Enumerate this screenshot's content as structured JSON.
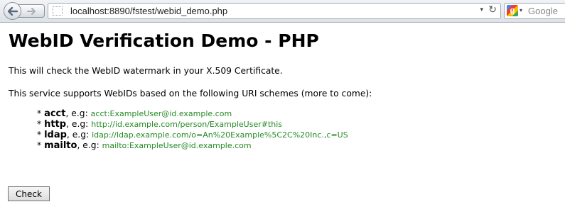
{
  "browser": {
    "url": "localhost:8890/fstest/webid_demo.php",
    "search_placeholder": "Google",
    "search_engine_letter": "g"
  },
  "page": {
    "title": "WebID Verification Demo - PHP",
    "intro": "This will check the WebID watermark in your X.509 Certificate.",
    "support_text": "This service supports WebIDs based on the following URI schemes (more to come):",
    "bullet": "*",
    "example_prefix": ", e.g:",
    "schemes": [
      {
        "name": "acct",
        "example": "acct:ExampleUser@id.example.com"
      },
      {
        "name": "http",
        "example": "http://id.example.com/person/ExampleUser#this"
      },
      {
        "name": "ldap",
        "example": "ldap://ldap.example.com/o=An%20Example%5C2C%20Inc.,c=US"
      },
      {
        "name": "mailto",
        "example": "mailto:ExampleUser@id.example.com"
      }
    ],
    "check_button": "Check"
  },
  "colors": {
    "example_link": "#238a23"
  }
}
